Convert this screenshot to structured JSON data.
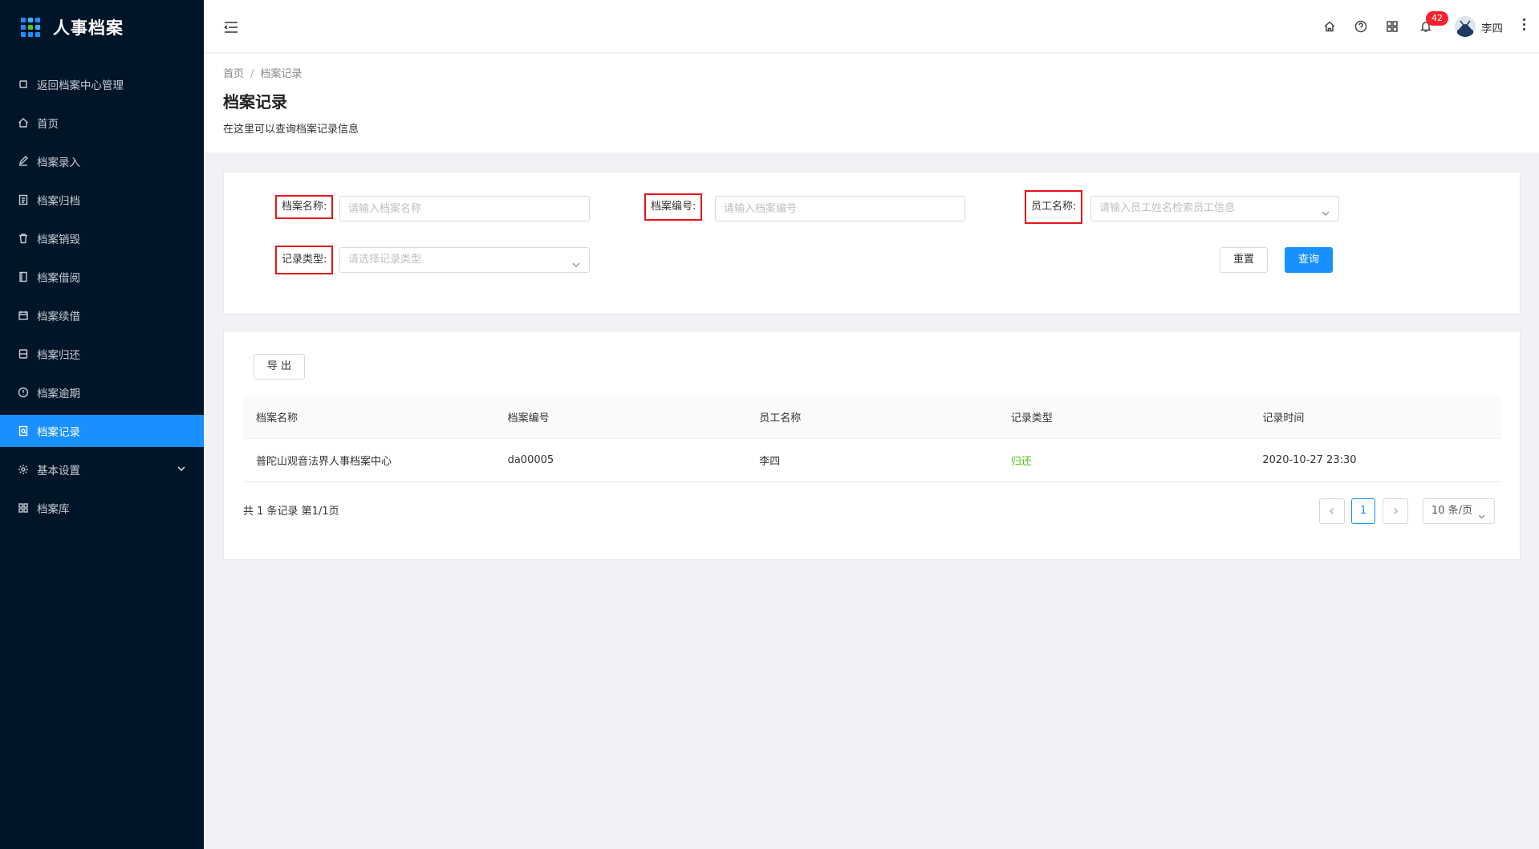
{
  "app": {
    "title": "人事档案"
  },
  "sidebar": {
    "items": [
      {
        "label": "返回档案中心管理",
        "icon": "return-icon"
      },
      {
        "label": "首页",
        "icon": "home-icon"
      },
      {
        "label": "档案录入",
        "icon": "edit-icon"
      },
      {
        "label": "档案归档",
        "icon": "archive-doc-icon"
      },
      {
        "label": "档案销毁",
        "icon": "trash-icon"
      },
      {
        "label": "档案借阅",
        "icon": "book-icon"
      },
      {
        "label": "档案续借",
        "icon": "renew-icon"
      },
      {
        "label": "档案归还",
        "icon": "return-box-icon"
      },
      {
        "label": "档案逾期",
        "icon": "alert-circle-icon"
      },
      {
        "label": "档案记录",
        "icon": "record-icon",
        "active": true
      },
      {
        "label": "基本设置",
        "icon": "gear-icon",
        "has_children": true
      },
      {
        "label": "档案库",
        "icon": "grid-icon"
      }
    ]
  },
  "header": {
    "notification_count": "42",
    "username": "李四"
  },
  "breadcrumb": {
    "home": "首页",
    "separator": "/",
    "current": "档案记录"
  },
  "page": {
    "title": "档案记录",
    "description": "在这里可以查询档案记录信息"
  },
  "search": {
    "archive_name_label": "档案名称:",
    "archive_name_placeholder": "请输入档案名称",
    "archive_no_label": "档案编号:",
    "archive_no_placeholder": "请输入档案编号",
    "employee_label": "员工名称:",
    "employee_placeholder": "请输入员工姓名检索员工信息",
    "record_type_label": "记录类型:",
    "record_type_placeholder": "请选择记录类型",
    "reset_label": "重置",
    "query_label": "查询"
  },
  "table": {
    "export_label": "导 出",
    "columns": [
      "档案名称",
      "档案编号",
      "员工名称",
      "记录类型",
      "记录时间"
    ],
    "rows": [
      [
        "普陀山观音法界人事档案中心",
        "da00005",
        "李四",
        "归还",
        "2020-10-27 23:30"
      ]
    ]
  },
  "pagination": {
    "summary": "共 1 条记录 第1/1页",
    "current_page": "1",
    "page_size": "10 条/页"
  },
  "colors": {
    "accent": "#1890ff",
    "sidebar_bg": "#011529",
    "status_green": "#52c41a",
    "highlight_red": "#e8131b",
    "badge_red": "#f5222d"
  }
}
